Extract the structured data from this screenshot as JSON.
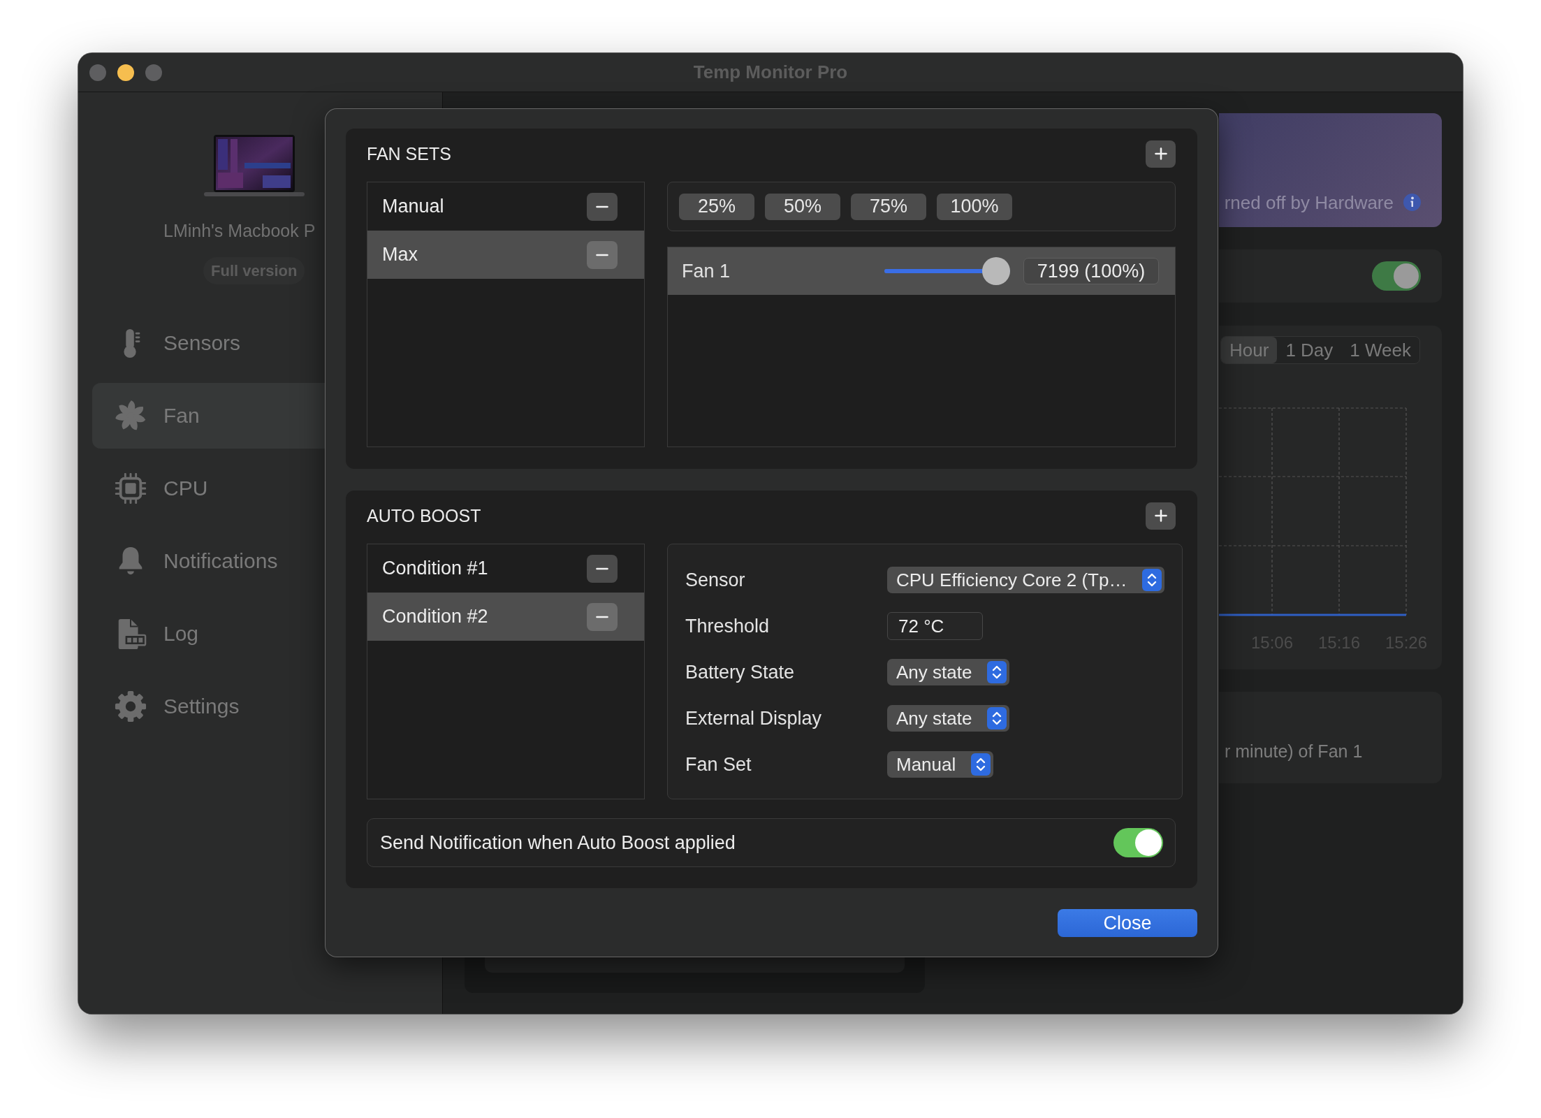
{
  "window": {
    "title": "Temp Monitor Pro",
    "controls": [
      {
        "kind": "close",
        "enabled": false
      },
      {
        "kind": "minimize",
        "enabled": true
      },
      {
        "kind": "zoom",
        "enabled": false
      }
    ]
  },
  "sidebar": {
    "device_name": "LMinh's Macbook P",
    "license_badge": "Full version",
    "items": [
      {
        "kind": "sensors",
        "label": "Sensors",
        "selected": false
      },
      {
        "kind": "fan",
        "label": "Fan",
        "selected": true
      },
      {
        "kind": "cpu",
        "label": "CPU",
        "selected": false
      },
      {
        "kind": "notifications",
        "label": "Notifications",
        "selected": false
      },
      {
        "kind": "log",
        "label": "Log",
        "selected": false
      },
      {
        "kind": "settings",
        "label": "Settings",
        "selected": false
      }
    ]
  },
  "main": {
    "banner": {
      "text": "rned off by Hardware"
    },
    "fan_control_toggle": {
      "on": true
    },
    "range_tabs": [
      {
        "label": "Hour",
        "selected": true
      },
      {
        "label": "1 Day",
        "selected": false
      },
      {
        "label": "1 Week",
        "selected": false
      }
    ],
    "chart_time_labels": [
      "15:06",
      "15:16",
      "15:26"
    ],
    "description": "r minute) of Fan 1"
  },
  "dialog": {
    "fan_sets": {
      "title": "FAN SETS",
      "sets": [
        {
          "name": "Manual",
          "selected": false
        },
        {
          "name": "Max",
          "selected": true
        }
      ],
      "presets": [
        "25%",
        "50%",
        "75%",
        "100%"
      ],
      "fans": [
        {
          "name": "Fan 1",
          "selected": true,
          "level": 1,
          "reading": "7199 (100%)"
        }
      ]
    },
    "auto_boost": {
      "title": "AUTO BOOST",
      "conditions": [
        {
          "name": "Condition #1",
          "selected": false
        },
        {
          "name": "Condition #2",
          "selected": true
        }
      ],
      "fields": [
        {
          "kind": "popup",
          "label": "Sensor",
          "value": "CPU Efficiency Core 2 (Tp…"
        },
        {
          "kind": "text",
          "label": "Threshold",
          "value": "72 °C"
        },
        {
          "kind": "popup",
          "label": "Battery State",
          "value": "Any state"
        },
        {
          "kind": "popup",
          "label": "External Display",
          "value": "Any state"
        },
        {
          "kind": "popup",
          "label": "Fan Set",
          "value": "Manual"
        }
      ],
      "notification": {
        "label": "Send Notification when Auto Boost applied",
        "on": true
      }
    },
    "close_button": "Close"
  }
}
